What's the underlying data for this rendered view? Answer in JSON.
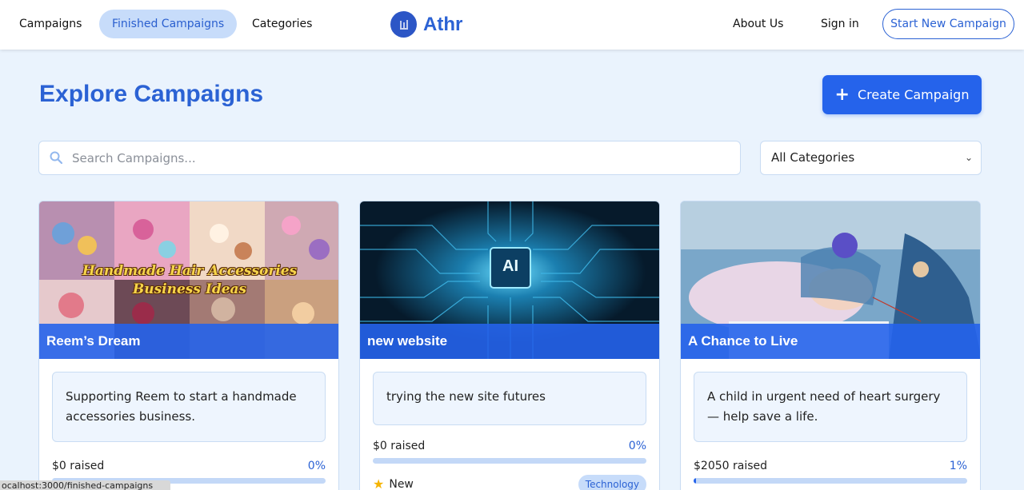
{
  "nav": {
    "links": [
      "Campaigns",
      "Finished Campaigns",
      "Categories"
    ],
    "brand": "Athr",
    "right_links": [
      "About Us",
      "Sign in"
    ],
    "start_campaign": "Start New Campaign"
  },
  "main": {
    "title": "Explore Campaigns",
    "create_button": "Create Campaign",
    "search_placeholder": "Search Campaigns...",
    "category_select": "All Categories"
  },
  "campaigns": [
    {
      "title": "Reem’s Dream",
      "description": "Supporting Reem to start a handmade accessories business.",
      "raised": "$0 raised",
      "percent": "0%",
      "progress": 0,
      "image_caption": [
        "Handmade Hair Accessories",
        "Business Ideas"
      ]
    },
    {
      "title": "new website",
      "description": "trying the new site futures",
      "raised": "$0 raised",
      "percent": "0%",
      "progress": 0,
      "badge": "New",
      "category": "Technology",
      "image_caption": [
        "AI"
      ]
    },
    {
      "title": "A Chance to Live",
      "description": "A child in urgent need of heart surgery — help save a life.",
      "raised": "$2050 raised",
      "percent": "1%",
      "progress": 1
    }
  ],
  "status_bar": "ocalhost:3000/finished-campaigns",
  "colors": {
    "accent": "#2563eb",
    "brand": "#2b62d4",
    "background": "#eaf3fd"
  }
}
